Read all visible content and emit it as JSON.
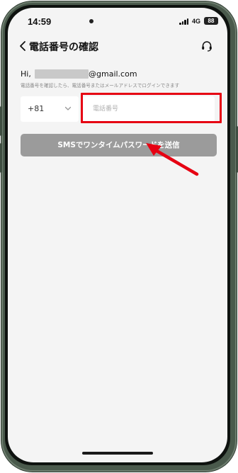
{
  "status_bar": {
    "time": "14:59",
    "network": "4G",
    "battery": "88"
  },
  "header": {
    "title": "電話番号の確認",
    "back_icon": "chevron-left-icon",
    "support_icon": "headset-icon"
  },
  "greeting": {
    "prefix": "Hi,",
    "email_domain": "@gmail.com"
  },
  "hint": "電話番号を確認したら、電話番号またはメールアドレスでログインできます",
  "form": {
    "country_code": "+81",
    "phone_placeholder": "電話番号",
    "phone_value": ""
  },
  "send_button": {
    "label": "SMSでワンタイムパスワードを送信"
  },
  "colors": {
    "annotation_red": "#e60012",
    "button_disabled": "#9b9b9b",
    "screen_background": "#f4f4f4"
  }
}
